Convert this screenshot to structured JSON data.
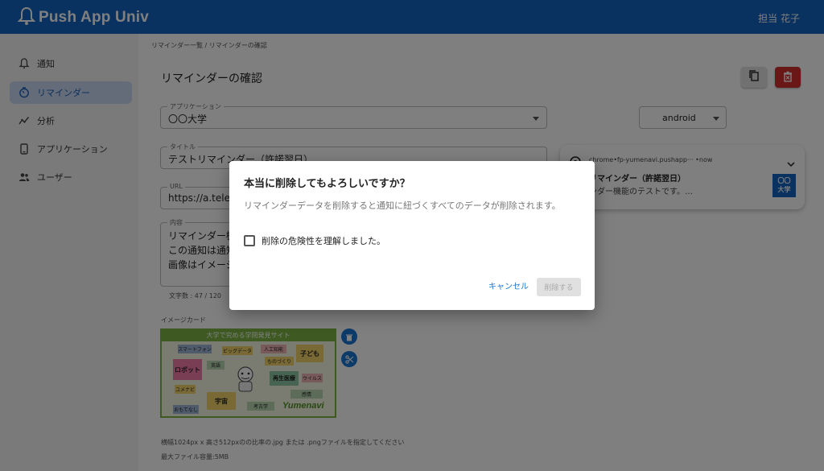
{
  "header": {
    "app_name": "Push App Univ",
    "user_name": "担当 花子",
    "brand_color": "#1565c0"
  },
  "sidebar": {
    "items": [
      {
        "label": "通知",
        "icon": "bell-icon",
        "active": false
      },
      {
        "label": "リマインダー",
        "icon": "timer-icon",
        "active": true
      },
      {
        "label": "分析",
        "icon": "analytics-icon",
        "active": false
      },
      {
        "label": "アプリケーション",
        "icon": "app-icon",
        "active": false
      },
      {
        "label": "ユーザー",
        "icon": "users-icon",
        "active": false
      }
    ]
  },
  "main": {
    "breadcrumb": "リマインダー一覧 / リマインダーの確認",
    "title": "リマインダーの確認",
    "copy_icon": "copy-icon",
    "delete_icon": "trash-icon",
    "delete_color": "#d32f2f",
    "form": {
      "application": {
        "label": "アプリケーション",
        "value": "〇〇大学"
      },
      "title": {
        "label": "タイトル",
        "value": "テストリマインダー（許諾翌日）"
      },
      "url": {
        "label": "URL",
        "value": "https://a.telem"
      },
      "content": {
        "label": "内容",
        "lines": [
          "リマインダー機",
          "この通知は通知",
          "画像はイメージ"
        ]
      },
      "char_count": "文字数 : 47 / 120"
    },
    "image_card": {
      "label": "イメージカード",
      "banner": "大学で究める学問発見サイト",
      "tags": [
        "スマートフォン",
        "ビッグデータ",
        "人工知能",
        "子ども",
        "ロボット",
        "英語",
        "ものづくり",
        "再生医療",
        "ウイルス",
        "宇宙",
        "考古学",
        "おもてなし",
        "感情",
        "ユメナビ"
      ],
      "logo": "Yumenavi"
    },
    "help_lines": [
      "横幅1024px x 高さ512pxのの比率の.jpg または .pngファイルを指定してください",
      "最大ファイル容量:5MB"
    ],
    "os_select": {
      "value": "android"
    },
    "preview": {
      "meta": "chrome•fp-yumenavi.pushapp··· •now",
      "title": "リマインダー（許諾翌日）",
      "body": "ンダー機能のテストです。…",
      "thumb_line1": "〇〇",
      "thumb_line2": "大学"
    }
  },
  "dialog": {
    "title": "本当に削除してもよろしいですか？",
    "message": "リマインダーデータを削除すると通知に紐づくすべてのデータが削除されます。",
    "checkbox_label": "削除の危険性を理解しました。",
    "checked": false,
    "cancel_label": "キャンセル",
    "confirm_label": "削除する",
    "confirm_enabled": false
  }
}
